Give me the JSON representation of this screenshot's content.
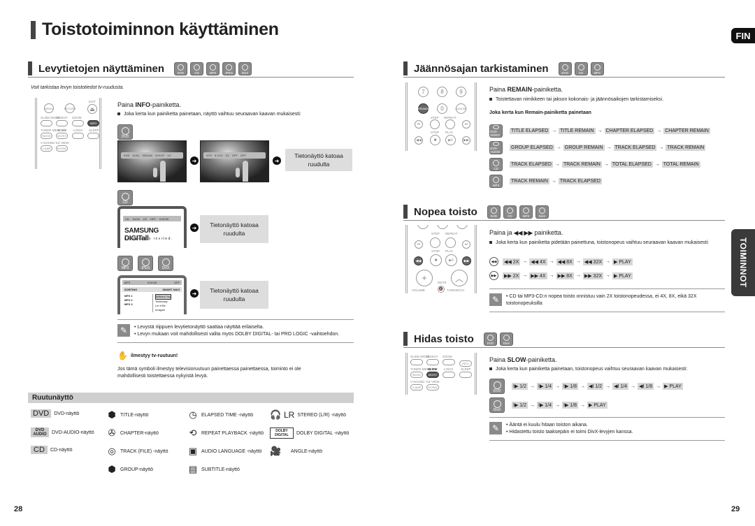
{
  "page": {
    "title": "Toistotoiminnon käyttäminen",
    "lang_tab": "FIN",
    "side_tab": "TOIMINNOT",
    "page_left": "28",
    "page_right": "29"
  },
  "disc_info": {
    "heading": "Levytietojen näyttäminen",
    "badges": [
      "DVD",
      "CD",
      "MP3",
      "JPEG",
      "DivX"
    ],
    "intro": "Voit tarkistaa levyn toistotiedot tv-ruudusta.",
    "instruction_prefix": "Paina ",
    "instruction_bold": "INFO",
    "instruction_suffix": "-painiketta.",
    "bullet": "Joka kerta kun painiketta painetaan, näyttö vaihtuu seuraavan kaavan mukaisesti:",
    "remote_labels": [
      "MENU",
      "RETURN",
      "EXIT",
      "SLIDE MODE",
      "DIGEST",
      "ZOOM",
      "INFO",
      "TUNER MEMORY",
      "SLOW",
      "LOGO",
      "SLEEP",
      "SD/HD",
      "MO/ST",
      "V-SOUND",
      "EZ VIEW",
      "V-AMP",
      "NT/PAL"
    ],
    "dvd_badge": "DVD",
    "cd_badge": "CD",
    "mp3_badges": [
      "MP3",
      "JPEG",
      "DivX"
    ],
    "disappear_text": "Tietonäyttö katoaa ruudulta",
    "osd_dvd_1": [
      "DVD",
      "01/01",
      "001/040",
      "0:00:37",
      "1/1"
    ],
    "osd_dvd_2": [
      "DTS",
      "5.1CH",
      "1/1",
      "OFF",
      "OFF"
    ],
    "osd_cd": [
      "CD",
      "01/20",
      "LR",
      "OFF",
      "0:00:00"
    ],
    "samsung_logo": "SAMSUNG DIGITall",
    "samsung_slogan": "everyone's invited.",
    "mp3_osd": {
      "top": [
        "MP3",
        "0:00:00",
        "OFF"
      ],
      "sorting": "SORTING",
      "smart_navi": "SMART NAVI",
      "folders": [
        "MP3 1",
        "MP3 2",
        "MP3 3"
      ],
      "tracks": [
        "Without You",
        "Yesterday",
        "Let It Be",
        "Imagine"
      ]
    },
    "notes": [
      "• Levystä riippuen levytietonäyttö saattaa näyttää erilaiselta.",
      "• Levyn mukaan voit mahdollisesti valita myös DOLBY DIGITAL- tai PRO LOGIC -vaihtoehdon."
    ],
    "hand_title": "ilmestyy tv-ruutuun!",
    "hand_text": "Jos tämä symboli ilmestyy televisioruutuun painettaessa painettaessa, toiminto ei ole mahdollisesti toistettaessa nykyistä levyä."
  },
  "legend": {
    "heading": "Ruutunäyttö",
    "items": [
      {
        "icon": "DVD",
        "label": "DVD-näyttö"
      },
      {
        "icon": "DVD AUDIO",
        "label": "DVD-AUDIO-näyttö"
      },
      {
        "icon": "CD",
        "label": "CD-näyttö"
      },
      {
        "icon": "title",
        "label": "TITLE-näyttö"
      },
      {
        "icon": "chapter",
        "label": "CHAPTER-näyttö"
      },
      {
        "icon": "track",
        "label": "TRACK (FILE) -näyttö"
      },
      {
        "icon": "group",
        "label": "GROUP-näyttö"
      },
      {
        "icon": "elapsed",
        "label": "ELAPSED TIME -näyttö"
      },
      {
        "icon": "repeat",
        "label": "REPEAT PLAYBACK -näyttö"
      },
      {
        "icon": "audio",
        "label": "AUDIO LANGUAGE -näyttö"
      },
      {
        "icon": "subtitle",
        "label": "SUBTITLE-näyttö"
      },
      {
        "icon": "LR",
        "label": "STEREO (L/R) -näyttö"
      },
      {
        "icon": "DOLBY DIGITAL",
        "label": "DOLBY DIGITAL -näyttö"
      },
      {
        "icon": "angle",
        "label": "ANGLE-näyttö"
      }
    ]
  },
  "remain": {
    "heading": "Jäännösajan tarkistaminen",
    "badges": [
      "DVD",
      "CD",
      "MP3"
    ],
    "instruction_prefix": "Paina ",
    "instruction_bold": "REMAIN",
    "instruction_suffix": "-painiketta.",
    "bullet": "Toistettavan nimikkeen tai jakson kokonais- ja jäännösaikojen tarkistamiseksi.",
    "sub_heading": "Joka kerta kun Remain-painiketta painetaan",
    "remote_labels": [
      "7",
      "8",
      "9",
      "REMAIN",
      "0",
      "CANCEL",
      "STEP",
      "REPEAT",
      "STOP",
      "PLAY"
    ],
    "rows": [
      {
        "badge": "DVD-VIDEO",
        "steps": [
          "TITLE ELAPSED",
          "TITLE REMAIN",
          "CHAPTER ELAPSED",
          "CHAPTER REMAIN"
        ]
      },
      {
        "badge": "DVD-AUDIO",
        "steps": [
          "GROUP ELAPSED",
          "GROUP REMAIN",
          "TRACK ELAPSED",
          "TRACK REMAIN"
        ]
      },
      {
        "badge": "CD",
        "steps": [
          "TRACK ELAPSED",
          "TRACK REMAIN",
          "TOTAL ELAPSED",
          "TOTAL REMAIN"
        ]
      },
      {
        "badge": "MP3",
        "steps": [
          "TRACK REMAIN",
          "TRACK ELAPSED"
        ]
      }
    ]
  },
  "fast": {
    "heading": "Nopea toisto",
    "badges": [
      "DVD",
      "CD",
      "MP3",
      "DivX"
    ],
    "instruction_prefix": "Paina ja ",
    "instruction_symbols": "◀◀ ▶▶",
    "instruction_suffix": " painiketta.",
    "bullet": "Joka kerta kun painiketta pidetään painettuna, toistonopeus vaihtuu seuraavan kaavan mukaisesti:",
    "remote_labels": [
      "STEP",
      "REPEAT",
      "STOP",
      "PLAY",
      "MUTE",
      "VOLUME",
      "TUNING/CH"
    ],
    "rows": [
      {
        "icon": "rewind",
        "steps": [
          "◀◀ 2X",
          "◀◀ 4X",
          "◀◀ 8X",
          "◀◀ 32X",
          "▶ PLAY"
        ]
      },
      {
        "icon": "forward",
        "steps": [
          "▶▶ 2X",
          "▶▶ 4X",
          "▶▶ 8X",
          "▶▶ 32X",
          "▶ PLAY"
        ]
      }
    ],
    "note": "• CD tai MP3-CD:n nopea toisto onnistuu vain 2X toistonopeudessa, ei 4X, 8X, eikä 32X toistonopeuksilla"
  },
  "slow": {
    "heading": "Hidas toisto",
    "badges": [
      "DVD",
      "DivX"
    ],
    "instruction_prefix": "Paina ",
    "instruction_bold": "SLOW",
    "instruction_suffix": "-painiketta.",
    "bullet": "Joka kerta kun painiketta painetaan, toistonopeus vaihtuu seuraavan kaavan mukaisesti:",
    "rows": [
      {
        "badge": "DVD",
        "steps": [
          "I▶ 1/2",
          "I▶ 1/4",
          "I▶ 1/8",
          "◀I 1/2",
          "◀I 1/4",
          "◀I 1/8",
          "▶ PLAY"
        ]
      },
      {
        "badge": "DivX",
        "steps": [
          "I▶ 1/2",
          "I▶ 1/4",
          "I▶ 1/8",
          "▶ PLAY"
        ]
      }
    ],
    "notes": [
      "• Ääntä ei kuulu hitaan toiston aikana.",
      "• Hidastettu toisto taaksepäin ei toimi DivX-levyjen kanssa."
    ]
  }
}
